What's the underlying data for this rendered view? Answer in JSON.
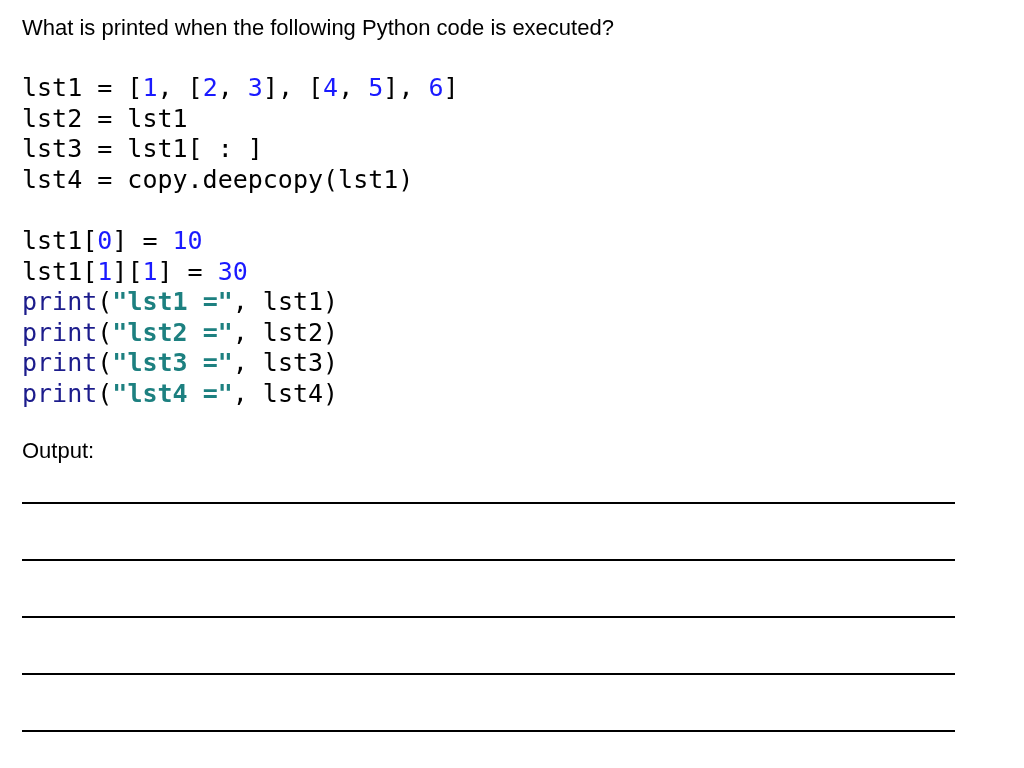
{
  "question": "What is printed when the following Python code is executed?",
  "code_blocks": [
    {
      "lines": [
        {
          "segments": [
            {
              "text": "lst1 = [",
              "kind": "plain"
            },
            {
              "text": "1",
              "kind": "number"
            },
            {
              "text": ", [",
              "kind": "plain"
            },
            {
              "text": "2",
              "kind": "number"
            },
            {
              "text": ", ",
              "kind": "plain"
            },
            {
              "text": "3",
              "kind": "number"
            },
            {
              "text": "], [",
              "kind": "plain"
            },
            {
              "text": "4",
              "kind": "number"
            },
            {
              "text": ", ",
              "kind": "plain"
            },
            {
              "text": "5",
              "kind": "number"
            },
            {
              "text": "], ",
              "kind": "plain"
            },
            {
              "text": "6",
              "kind": "number"
            },
            {
              "text": "]",
              "kind": "plain"
            }
          ]
        },
        {
          "segments": [
            {
              "text": "lst2 = lst1",
              "kind": "plain"
            }
          ]
        },
        {
          "segments": [
            {
              "text": "lst3 = lst1[ : ]",
              "kind": "plain"
            }
          ]
        },
        {
          "segments": [
            {
              "text": "lst4 = copy.deepcopy(lst1)",
              "kind": "plain"
            }
          ]
        }
      ]
    },
    {
      "lines": [
        {
          "segments": [
            {
              "text": "lst1[",
              "kind": "plain"
            },
            {
              "text": "0",
              "kind": "number"
            },
            {
              "text": "] = ",
              "kind": "plain"
            },
            {
              "text": "10",
              "kind": "number"
            }
          ]
        },
        {
          "segments": [
            {
              "text": "lst1[",
              "kind": "plain"
            },
            {
              "text": "1",
              "kind": "number"
            },
            {
              "text": "][",
              "kind": "plain"
            },
            {
              "text": "1",
              "kind": "number"
            },
            {
              "text": "] = ",
              "kind": "plain"
            },
            {
              "text": "30",
              "kind": "number"
            }
          ]
        },
        {
          "segments": [
            {
              "text": "print",
              "kind": "builtin"
            },
            {
              "text": "(",
              "kind": "plain"
            },
            {
              "text": "\"lst1 =\"",
              "kind": "string"
            },
            {
              "text": ", lst1)",
              "kind": "plain"
            }
          ]
        },
        {
          "segments": [
            {
              "text": "print",
              "kind": "builtin"
            },
            {
              "text": "(",
              "kind": "plain"
            },
            {
              "text": "\"lst2 =\"",
              "kind": "string"
            },
            {
              "text": ", lst2)",
              "kind": "plain"
            }
          ]
        },
        {
          "segments": [
            {
              "text": "print",
              "kind": "builtin"
            },
            {
              "text": "(",
              "kind": "plain"
            },
            {
              "text": "\"lst3 =\"",
              "kind": "string"
            },
            {
              "text": ", lst3)",
              "kind": "plain"
            }
          ]
        },
        {
          "segments": [
            {
              "text": "print",
              "kind": "builtin"
            },
            {
              "text": "(",
              "kind": "plain"
            },
            {
              "text": "\"lst4 =\"",
              "kind": "string"
            },
            {
              "text": ", lst4)",
              "kind": "plain"
            }
          ]
        }
      ]
    }
  ],
  "output": {
    "label": "Output:",
    "answer_lines": [
      {
        "kind": "blank"
      },
      {
        "kind": "blank"
      },
      {
        "kind": "blank"
      },
      {
        "kind": "blank"
      },
      {
        "kind": "blank"
      }
    ]
  }
}
